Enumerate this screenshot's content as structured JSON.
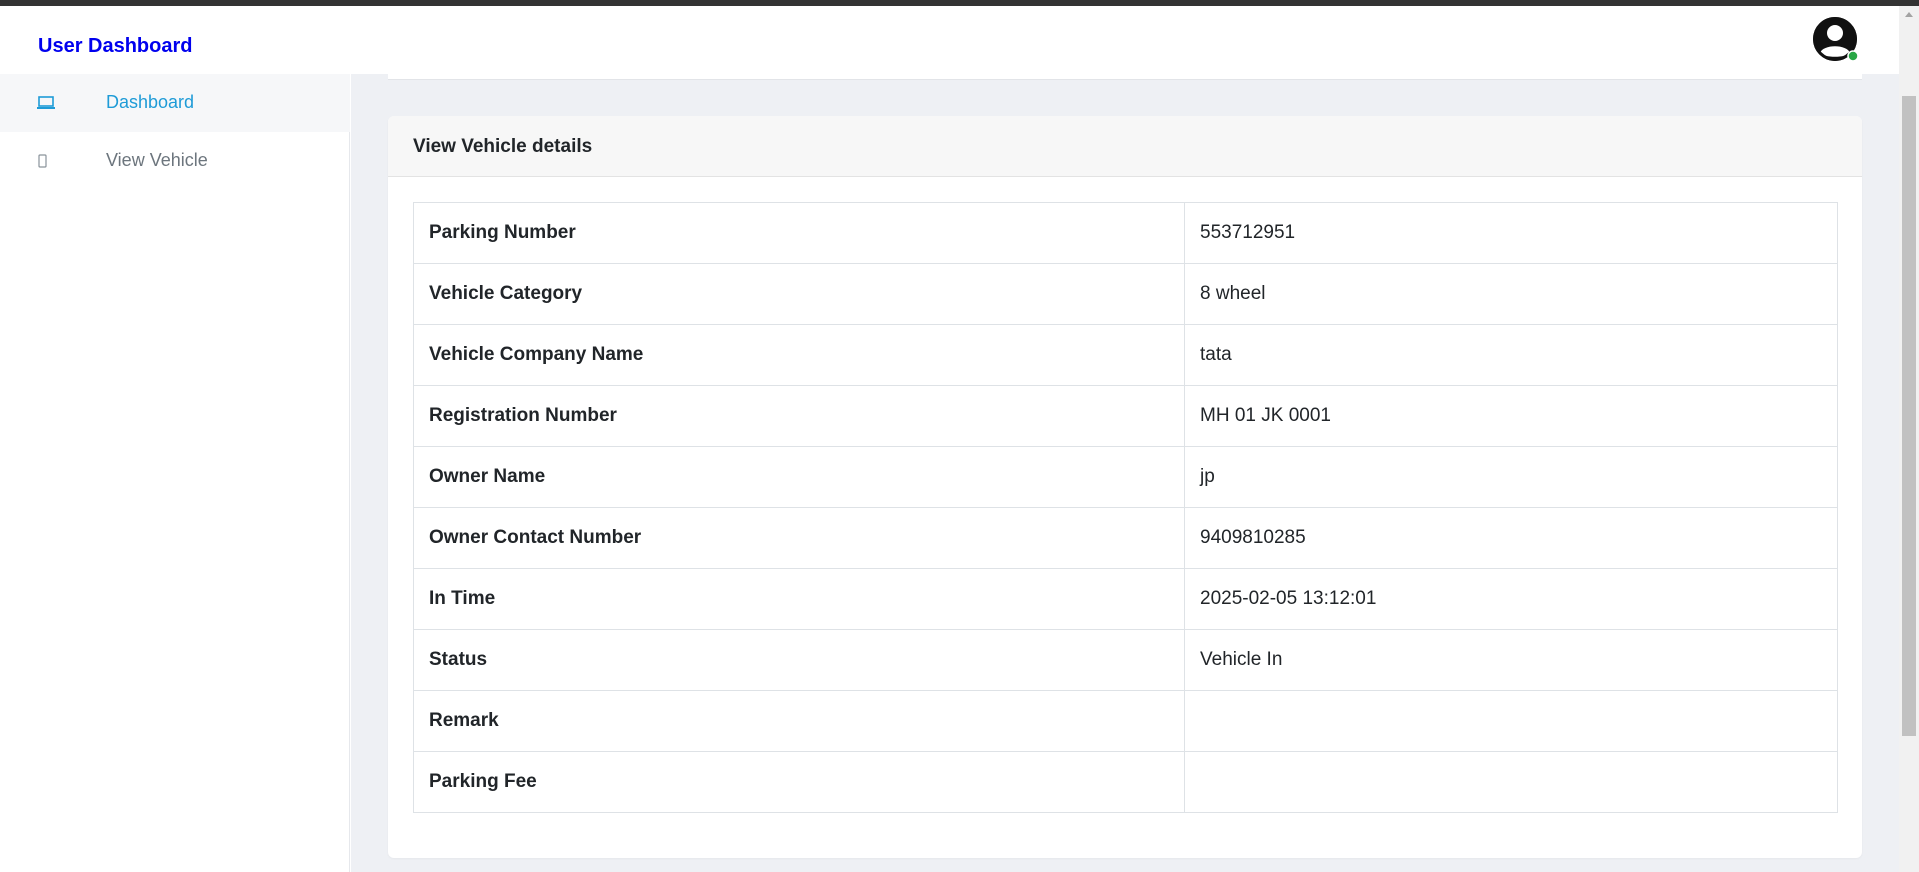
{
  "header": {
    "brand": "User Dashboard"
  },
  "sidebar": {
    "items": [
      {
        "label": "Dashboard",
        "icon": "laptop-icon",
        "active": true
      },
      {
        "label": "View Vehicle",
        "icon": "mobile-icon",
        "active": false
      }
    ]
  },
  "card": {
    "title": "View Vehicle details"
  },
  "details": {
    "rows": [
      {
        "label": "Parking Number",
        "value": "553712951"
      },
      {
        "label": "Vehicle Category",
        "value": "8 wheel"
      },
      {
        "label": "Vehicle Company Name",
        "value": "tata"
      },
      {
        "label": "Registration Number",
        "value": "MH 01 JK 0001"
      },
      {
        "label": "Owner Name",
        "value": "jp"
      },
      {
        "label": "Owner Contact Number",
        "value": "9409810285"
      },
      {
        "label": "In Time",
        "value": "2025-02-05 13:12:01"
      },
      {
        "label": "Status",
        "value": "Vehicle In"
      },
      {
        "label": "Remark",
        "value": ""
      },
      {
        "label": "Parking Fee",
        "value": ""
      }
    ]
  },
  "colors": {
    "brand": "#0000ee",
    "active_nav": "#1e9bd7",
    "online_status": "#28a745"
  }
}
